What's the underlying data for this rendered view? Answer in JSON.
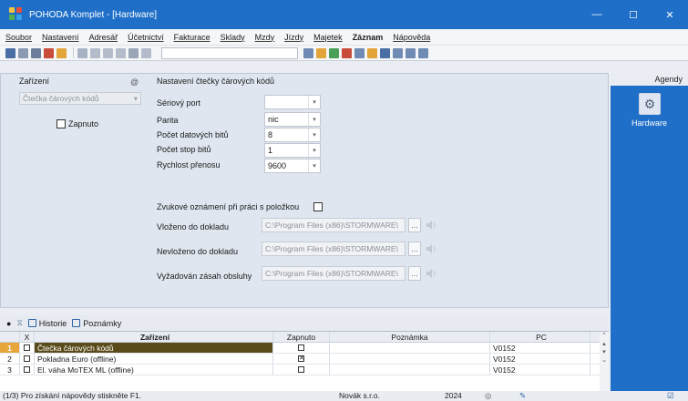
{
  "window": {
    "title": "POHODA Komplet - [Hardware]"
  },
  "menu": [
    "Soubor",
    "Nastavení",
    "Adresář",
    "Účetnictví",
    "Fakturace",
    "Sklady",
    "Mzdy",
    "Jízdy",
    "Majetek",
    "Záznam",
    "Nápověda"
  ],
  "left": {
    "heading": "Zařízení",
    "device_select": "Čtečka čárových kódů",
    "enabled_label": "Zapnuto"
  },
  "config": {
    "heading": "Nastavení čtečky čárových kódů",
    "serial_port_label": "Sériový port",
    "parity_label": "Parita",
    "parity_value": "nic",
    "data_bits_label": "Počet datových bitů",
    "data_bits_value": "8",
    "stop_bits_label": "Počet stop bitů",
    "stop_bits_value": "1",
    "speed_label": "Rychlost přenosu",
    "speed_value": "9600",
    "sound_label": "Zvukové oznámení při práci s položkou",
    "inserted_label": "Vloženo do dokladu",
    "inserted_path": "C:\\Program Files (x86)\\STORMWARE\\",
    "not_inserted_label": "Nevloženo do dokladu",
    "not_inserted_path": "C:\\Program Files (x86)\\STORMWARE\\",
    "required_label": "Vyžadován zásah obsluhy",
    "required_path": "C:\\Program Files (x86)\\STORMWARE\\"
  },
  "agendy": {
    "heading": "Agendy",
    "hardware_label": "Hardware"
  },
  "tabs": {
    "history": "Historie",
    "notes": "Poznámky"
  },
  "grid": {
    "headers": {
      "x": "X",
      "device": "Zařízení",
      "enabled": "Zapnuto",
      "note": "Poznámka",
      "pc": "PC"
    },
    "rows": [
      {
        "num": "1",
        "name": "Čtečka čárových kódů",
        "enabled": false,
        "pc": "V0152"
      },
      {
        "num": "2",
        "name": "Pokladna Euro (offline)",
        "enabled": true,
        "pc": "V0152"
      },
      {
        "num": "3",
        "name": "El. váha MoTEX ML (offline)",
        "enabled": false,
        "pc": "V0152"
      }
    ]
  },
  "status": {
    "hint": "(1/3) Pro získání nápovědy stiskněte F1.",
    "company": "Novák s.r.o.",
    "year": "2024"
  }
}
